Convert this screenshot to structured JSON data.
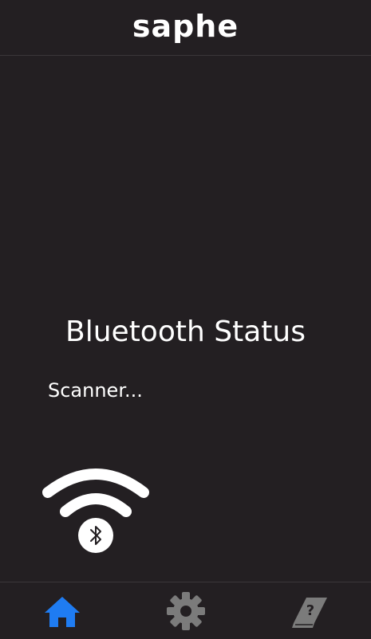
{
  "header": {
    "logo_text": "saphe"
  },
  "main": {
    "title": "Bluetooth Status",
    "status_text": "Scanner..."
  },
  "bluetooth_graphic": {
    "icon": "bluetooth-scanning-icon"
  },
  "bottom_nav": {
    "items": [
      {
        "icon": "home-icon",
        "active": true
      },
      {
        "icon": "gear-icon",
        "active": false
      },
      {
        "icon": "help-book-icon",
        "active": false
      }
    ]
  },
  "colors": {
    "background": "#231f22",
    "text": "#ffffff",
    "active_nav": "#1f7cf2",
    "inactive_nav": "#7b7b7b",
    "divider": "#3b373a"
  }
}
